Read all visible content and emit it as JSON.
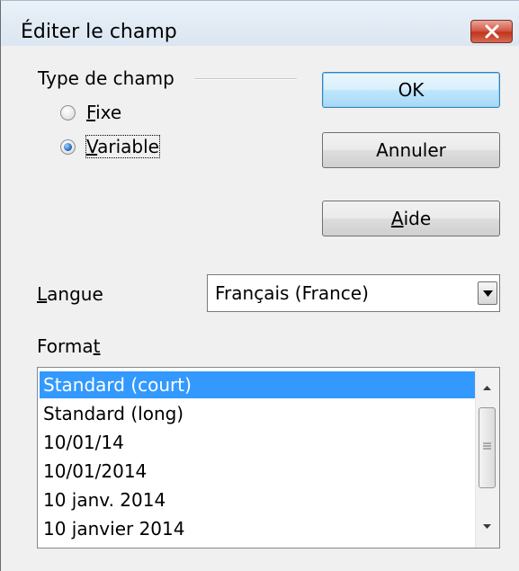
{
  "window": {
    "title": "Éditer le champ",
    "close_icon": "close-icon"
  },
  "field_type": {
    "group_label": "Type de champ",
    "options": [
      {
        "label": "Fixe",
        "mnemonic_index": 0,
        "checked": false
      },
      {
        "label": "Variable",
        "mnemonic_index": 0,
        "checked": true
      }
    ]
  },
  "buttons": {
    "ok": "OK",
    "cancel": "Annuler",
    "help": "Aide"
  },
  "language": {
    "label": "Langue",
    "value": "Français (France)",
    "arrow_icon": "chevron-down-icon"
  },
  "format": {
    "label": "Format",
    "items": [
      {
        "label": "Standard (court)",
        "selected": true
      },
      {
        "label": "Standard (long)",
        "selected": false
      },
      {
        "label": "10/01/14",
        "selected": false
      },
      {
        "label": "10/01/2014",
        "selected": false
      },
      {
        "label": "10 janv. 2014",
        "selected": false
      },
      {
        "label": "10 janvier 2014",
        "selected": false
      }
    ]
  },
  "colors": {
    "selection": "#3399ff",
    "close_button": "#c7402a",
    "default_button_border": "#3c7fb1"
  }
}
